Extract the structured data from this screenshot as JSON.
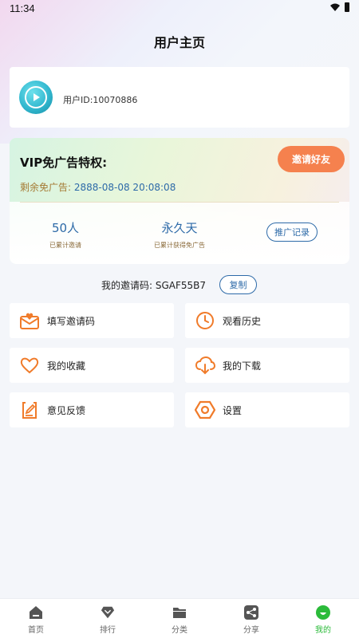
{
  "status_bar": {
    "time": "11:34"
  },
  "header": {
    "title": "用户主页"
  },
  "user": {
    "id_text": "用户ID:10070886"
  },
  "vip": {
    "title": "VIP免广告特权:",
    "remaining_label": "剩余免广告:",
    "remaining_value": "2888-08-08 20:08:08",
    "invite_friend_label": "邀请好友",
    "stats": [
      {
        "value": "50人",
        "label": "已累计邀请"
      },
      {
        "value": "永久天",
        "label": "已累计获得免广告"
      }
    ],
    "promo_records_label": "推广记录"
  },
  "invite_code": {
    "label": "我的邀请码: SGAF55B7",
    "copy_label": "复制"
  },
  "tiles": [
    {
      "label": "填写邀请码",
      "icon": "mail-heart-icon"
    },
    {
      "label": "观看历史",
      "icon": "clock-icon"
    },
    {
      "label": "我的收藏",
      "icon": "heart-icon"
    },
    {
      "label": "我的下载",
      "icon": "cloud-download-icon"
    },
    {
      "label": "意见反馈",
      "icon": "edit-note-icon"
    },
    {
      "label": "设置",
      "icon": "hexagon-settings-icon"
    }
  ],
  "bottom_nav": [
    {
      "label": "首页",
      "icon": "home-icon"
    },
    {
      "label": "排行",
      "icon": "diamond-rank-icon"
    },
    {
      "label": "分类",
      "icon": "folder-icon"
    },
    {
      "label": "分享",
      "icon": "share-icon"
    },
    {
      "label": "我的",
      "icon": "profile-icon",
      "active": true
    }
  ],
  "colors": {
    "accent": "#f5814e",
    "link": "#2d6aa8",
    "active_nav": "#2bbb3a",
    "icon_orange": "#f07b2a"
  }
}
